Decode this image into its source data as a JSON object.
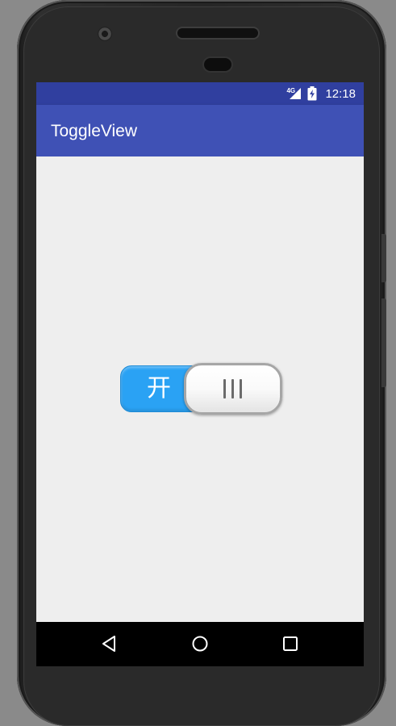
{
  "status_bar": {
    "network_label": "4G",
    "time": "12:18",
    "icons": [
      "signal-icon",
      "battery-charging-icon"
    ]
  },
  "app_bar": {
    "title": "ToggleView"
  },
  "toggle": {
    "on_label": "开",
    "state": "on",
    "track_color": "#2aa2f4",
    "thumb_icon": "grip-lines-icon"
  },
  "nav_bar": {
    "buttons": [
      "back-icon",
      "home-icon",
      "recents-icon"
    ]
  },
  "colors": {
    "status_bar": "#303f9f",
    "app_bar": "#3f51b5",
    "background": "#eeeeee"
  }
}
